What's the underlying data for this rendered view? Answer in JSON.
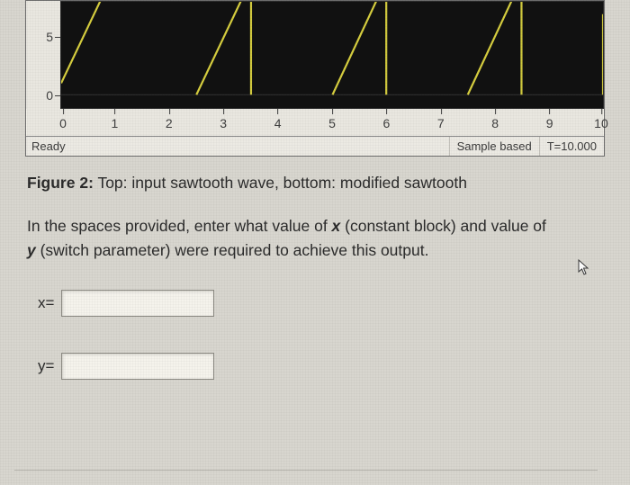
{
  "chart_data": {
    "type": "line",
    "title": "",
    "xlabel": "",
    "ylabel": "",
    "xlim": [
      0,
      10
    ],
    "ylim_visible": [
      -1,
      7
    ],
    "x_ticks": [
      0,
      1,
      2,
      3,
      4,
      5,
      6,
      7,
      8,
      9,
      10
    ],
    "y_ticks_visible": [
      0,
      5
    ],
    "series": [
      {
        "name": "modified-sawtooth",
        "color": "#d7cf3f",
        "segments": [
          [
            [
              0.0,
              1.0
            ],
            [
              0.9,
              10.0
            ]
          ],
          [
            [
              2.5,
              0.0
            ],
            [
              3.5,
              10.0
            ]
          ],
          [
            [
              3.5,
              0.0
            ],
            [
              3.5,
              10.0
            ]
          ],
          [
            [
              5.0,
              0.0
            ],
            [
              6.0,
              10.0
            ]
          ],
          [
            [
              6.0,
              0.0
            ],
            [
              6.0,
              10.0
            ]
          ],
          [
            [
              7.5,
              0.0
            ],
            [
              8.5,
              10.0
            ]
          ],
          [
            [
              8.5,
              0.0
            ],
            [
              8.5,
              10.0
            ]
          ],
          [
            [
              10.0,
              0.0
            ],
            [
              10.0,
              7.0
            ]
          ]
        ]
      }
    ]
  },
  "status": {
    "ready": "Ready",
    "mode": "Sample based",
    "time": "T=10.000"
  },
  "caption": {
    "fig_label": "Figure 2:",
    "text": " Top: input sawtooth wave, bottom: modified sawtooth"
  },
  "prompt": {
    "line1a": "In the spaces provided, enter what value of ",
    "xvar": "x",
    "line1b": " (constant block) and value of",
    "line2a": "",
    "yvar": "y",
    "line2b": " (switch parameter) were required to achieve this output."
  },
  "fields": {
    "x_label": "x=",
    "y_label": "y=",
    "x_value": "",
    "y_value": ""
  }
}
